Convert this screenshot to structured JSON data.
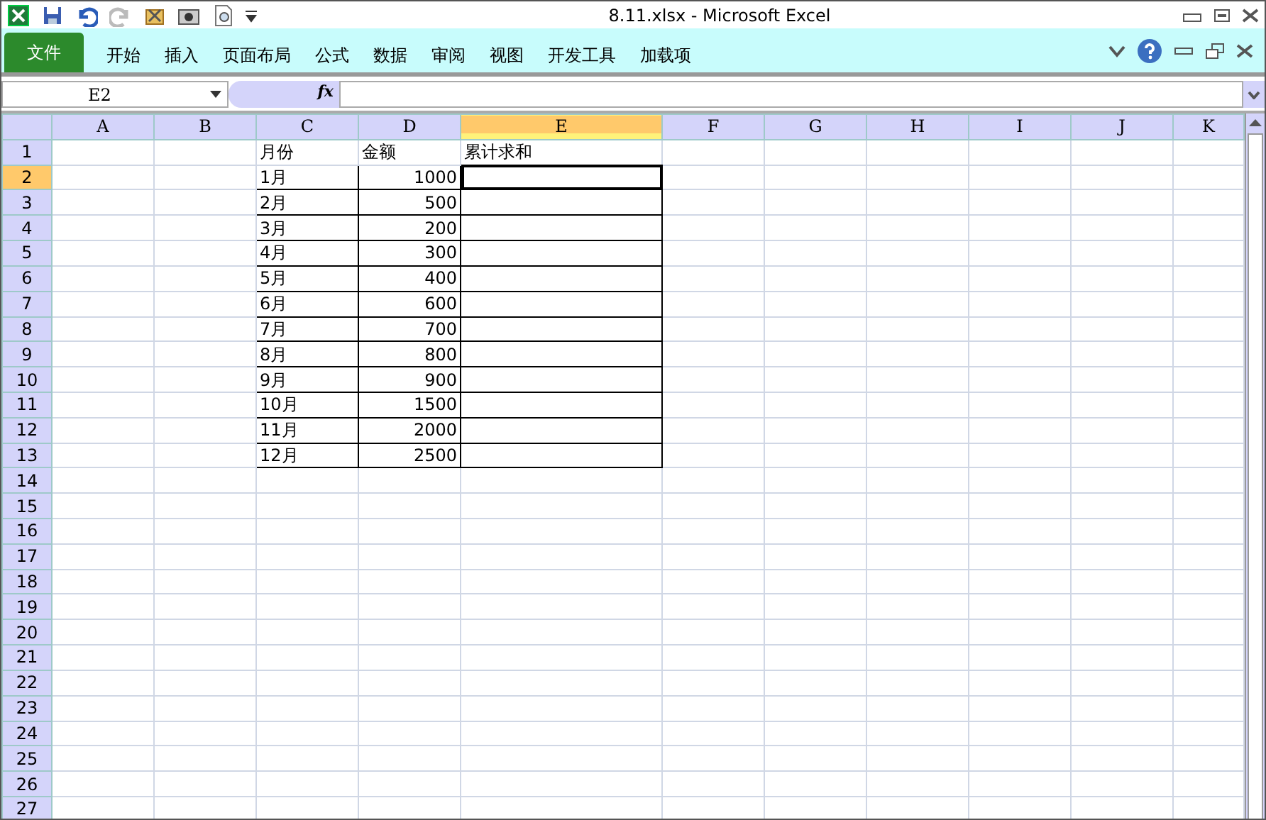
{
  "window": {
    "title": "8.11.xlsx  -  Microsoft Excel"
  },
  "ribbon_tabs": [
    {
      "label": "文件",
      "kind": "file",
      "selected": false
    },
    {
      "label": "开始",
      "kind": "tab",
      "selected": false
    },
    {
      "label": "插入",
      "kind": "tab",
      "selected": false
    },
    {
      "label": "页面布局",
      "kind": "tab",
      "selected": false
    },
    {
      "label": "公式",
      "kind": "tab",
      "selected": false
    },
    {
      "label": "数据",
      "kind": "tab",
      "selected": false
    },
    {
      "label": "审阅",
      "kind": "tab",
      "selected": false
    },
    {
      "label": "视图",
      "kind": "tab",
      "selected": false
    },
    {
      "label": "开发工具",
      "kind": "tab",
      "selected": false
    },
    {
      "label": "加载项",
      "kind": "tab",
      "selected": false
    }
  ],
  "formula_bar": {
    "name_box": "E2",
    "function_label": "fx"
  },
  "columns": [
    {
      "label": "A",
      "selected": false
    },
    {
      "label": "B",
      "selected": false
    },
    {
      "label": "C",
      "selected": false
    },
    {
      "label": "D",
      "selected": false
    },
    {
      "label": "E",
      "selected": true
    },
    {
      "label": "F",
      "selected": false
    },
    {
      "label": "G",
      "selected": false
    },
    {
      "label": "H",
      "selected": false
    },
    {
      "label": "I",
      "selected": false
    },
    {
      "label": "J",
      "selected": false
    },
    {
      "label": "K",
      "selected": false
    }
  ],
  "row_headers": [
    {
      "label": "1",
      "selected": false
    },
    {
      "label": "2",
      "selected": true
    },
    {
      "label": "3",
      "selected": false
    },
    {
      "label": "4",
      "selected": false
    },
    {
      "label": "5",
      "selected": false
    },
    {
      "label": "6",
      "selected": false
    },
    {
      "label": "7",
      "selected": false
    },
    {
      "label": "8",
      "selected": false
    },
    {
      "label": "9",
      "selected": false
    },
    {
      "label": "10",
      "selected": false
    },
    {
      "label": "11",
      "selected": false
    },
    {
      "label": "12",
      "selected": false
    },
    {
      "label": "13",
      "selected": false
    },
    {
      "label": "14",
      "selected": false
    },
    {
      "label": "15",
      "selected": false
    },
    {
      "label": "16",
      "selected": false
    },
    {
      "label": "17",
      "selected": false
    },
    {
      "label": "18",
      "selected": false
    },
    {
      "label": "19",
      "selected": false
    },
    {
      "label": "20",
      "selected": false
    },
    {
      "label": "21",
      "selected": false
    },
    {
      "label": "22",
      "selected": false
    },
    {
      "label": "23",
      "selected": false
    },
    {
      "label": "24",
      "selected": false
    },
    {
      "label": "25",
      "selected": false
    },
    {
      "label": "26",
      "selected": false
    },
    {
      "label": "27",
      "selected": false
    }
  ],
  "table": {
    "header": [
      "月份",
      "金额",
      "累计求和"
    ],
    "rows": [
      {
        "month": "1月",
        "amount": "1000"
      },
      {
        "month": "2月",
        "amount": "500"
      },
      {
        "month": "3月",
        "amount": "200"
      },
      {
        "month": "4月",
        "amount": "300"
      },
      {
        "month": "5月",
        "amount": "400"
      },
      {
        "month": "6月",
        "amount": "600"
      },
      {
        "month": "7月",
        "amount": "700"
      },
      {
        "month": "8月",
        "amount": "800"
      },
      {
        "month": "9月",
        "amount": "900"
      },
      {
        "month": "10月",
        "amount": "1500"
      },
      {
        "month": "11月",
        "amount": "2000"
      },
      {
        "month": "12月",
        "amount": "2500"
      }
    ]
  }
}
